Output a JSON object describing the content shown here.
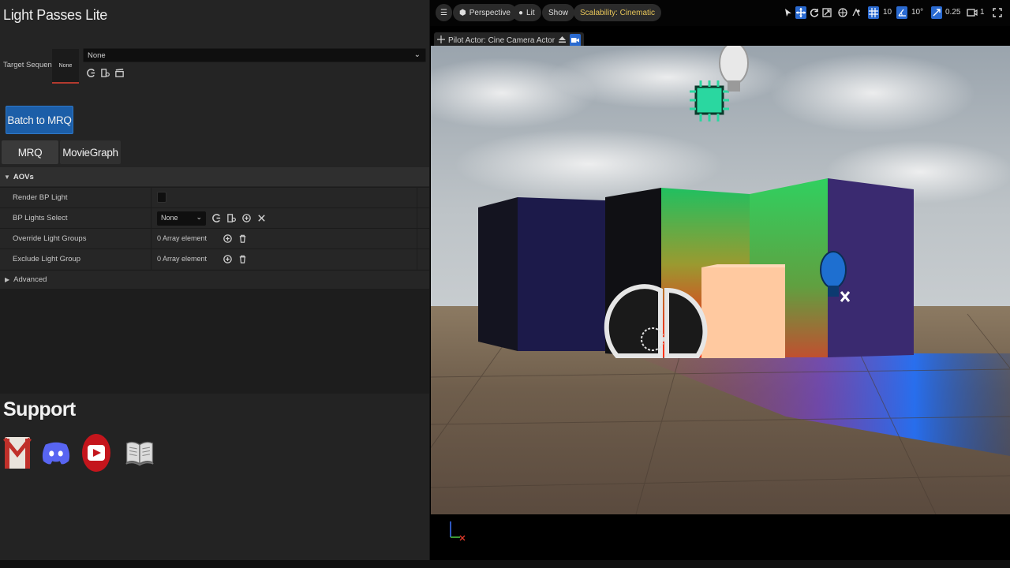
{
  "panel": {
    "title": "Light Passes Lite",
    "target_sequence": {
      "label": "Target Sequence",
      "thumb_text": "None",
      "value": "None"
    },
    "batch_button": "Batch to MRQ",
    "tabs": [
      {
        "label": "MRQ"
      },
      {
        "label": "MovieGraph"
      }
    ],
    "section": "AOVs",
    "rows": {
      "render_bp_light": {
        "label": "Render BP Light",
        "checked": false
      },
      "bp_lights_select": {
        "label": "BP Lights Select",
        "value": "None"
      },
      "override_light_groups": {
        "label": "Override Light Groups",
        "value": "0 Array element"
      },
      "exclude_light_group": {
        "label": "Exclude Light Group",
        "value": "0 Array element"
      }
    },
    "advanced": "Advanced",
    "support": {
      "title": "Support",
      "icons": [
        "gmail-icon",
        "discord-icon",
        "youtube-icon",
        "documentation-book-icon"
      ]
    }
  },
  "viewport": {
    "toolbar": {
      "view_mode": "Perspective",
      "lighting": "Lit",
      "show": "Show",
      "scalability": "Scalability: Cinematic",
      "grid_snap": "10",
      "rotation_snap": "10°",
      "scale_snap": "0.25",
      "camera_speed": "1"
    },
    "pilot_label": "Pilot Actor: Cine Camera Actor",
    "colors": {
      "accent": "#2a6ad0",
      "scalability_text": "#e8c65a",
      "batch_button": "#1c5ea8"
    }
  }
}
